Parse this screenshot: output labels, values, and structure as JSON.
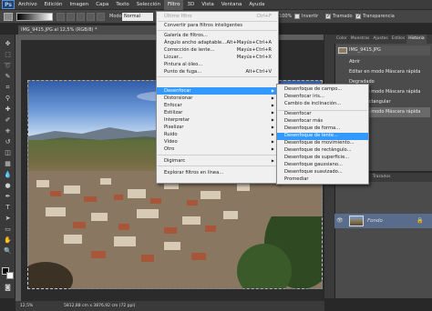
{
  "app": {
    "logo": "Ps"
  },
  "menubar": {
    "items": [
      "Archivo",
      "Edición",
      "Imagen",
      "Capa",
      "Texto",
      "Selección",
      "Filtro",
      "3D",
      "Vista",
      "Ventana",
      "Ayuda"
    ],
    "active": "Filtro"
  },
  "options": {
    "mode_label": "Modo",
    "mode_value": "Normal",
    "opacity_label": "Opacidad:",
    "opacity_value": "100%",
    "invert_label": "Invertir",
    "dither_label": "Tramado",
    "transparency_label": "Transparencia"
  },
  "document": {
    "tab_title": "IMG_9415.JPG al 12,5% (RGB/8) *",
    "zoom": "12,5%",
    "info": "5812,88 cm x 3876,92 cm (72 ppi)"
  },
  "filter_menu": {
    "items": [
      {
        "label": "Último filtro",
        "shortcut": "Ctrl+F",
        "disabled": true
      },
      {
        "label": "Convertir para filtros inteligentes"
      },
      {
        "label": "Galería de filtros..."
      },
      {
        "label": "Ángulo ancho adaptable...",
        "shortcut": "Alt+Mayús+Ctrl+A"
      },
      {
        "label": "Corrección de lente...",
        "shortcut": "Mayús+Ctrl+R"
      },
      {
        "label": "Licuar...",
        "shortcut": "Mayús+Ctrl+X"
      },
      {
        "label": "Pintura al óleo..."
      },
      {
        "label": "Punto de fuga...",
        "shortcut": "Alt+Ctrl+V"
      },
      {
        "label": "Desenfocar",
        "submenu": true,
        "highlighted": true
      },
      {
        "label": "Distorsionar",
        "submenu": true
      },
      {
        "label": "Enfocar",
        "submenu": true
      },
      {
        "label": "Estilizar",
        "submenu": true
      },
      {
        "label": "Interpretar",
        "submenu": true
      },
      {
        "label": "Pixelizar",
        "submenu": true
      },
      {
        "label": "Ruido",
        "submenu": true
      },
      {
        "label": "Vídeo",
        "submenu": true
      },
      {
        "label": "Otro",
        "submenu": true
      },
      {
        "label": "Digimarc",
        "submenu": true
      },
      {
        "label": "Explorar filtros en línea..."
      }
    ]
  },
  "blur_submenu": {
    "items": [
      "Desenfoque de campo...",
      "Desenfocar iris...",
      "Cambio de inclinación...",
      "Desenfocar",
      "Desenfocar más",
      "Desenfoque de forma...",
      "Desenfoque de lente...",
      "Desenfoque de movimiento...",
      "Desenfoque de rectángulo...",
      "Desenfoque de superficie...",
      "Desenfoque gaussiano...",
      "Desenfoque suavizado...",
      "Promediar"
    ],
    "highlighted": "Desenfoque de lente..."
  },
  "history_panel": {
    "tabs": [
      "Color",
      "Muestras",
      "Ajustes",
      "Estilos",
      "Historia"
    ],
    "active_tab": "Historia",
    "snapshot": "IMG_9415.JPG",
    "items": [
      "Abrir",
      "Editar en modo Máscara rápida",
      "Degradado",
      "Editar en modo Máscara rápida",
      "Marco rectangular",
      "Editar en modo Máscara rápida"
    ]
  },
  "layers_panel": {
    "tabs": [
      "Capas",
      "Canales",
      "Trazados"
    ],
    "layer_name": "Fondo"
  },
  "colors": {
    "menu_highlight": "#3399ff",
    "ui_dark": "#3a3a3a",
    "menu_bg": "#f0f0f0"
  }
}
